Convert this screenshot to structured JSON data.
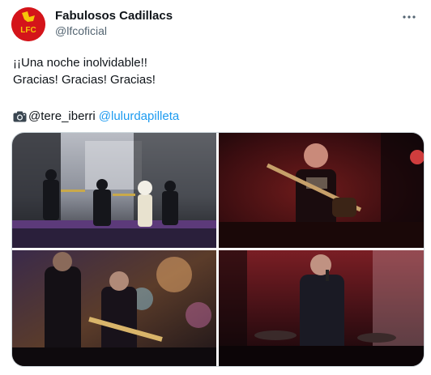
{
  "author": {
    "name": "Fabulosos Cadillacs",
    "handle": "@lfcoficial",
    "avatar_text": "LFC"
  },
  "tweet": {
    "line1": "¡¡Una noche inolvidable!!",
    "line2": "Gracias! Gracias! Gracias!",
    "credit_prefix": "@tere_iberri",
    "credit_mention": "@lulurdapilleta"
  },
  "icons": {
    "more": "more-horizontal-icon",
    "camera": "camera-emoji-icon"
  },
  "colors": {
    "avatar_bg": "#d4141a",
    "avatar_accent": "#f6c40a",
    "mention": "#1d9bf0",
    "secondary_text": "#536471"
  }
}
